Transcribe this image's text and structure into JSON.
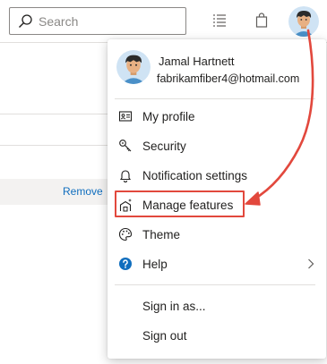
{
  "header": {
    "search_placeholder": "Search",
    "icons": [
      "search-icon",
      "work-items-icon",
      "marketplace-bag-icon",
      "user-avatar"
    ]
  },
  "background": {
    "remove_link": "Remove"
  },
  "profile": {
    "name": "Jamal Hartnett",
    "email": "fabrikamfiber4@hotmail.com"
  },
  "menu": {
    "items": [
      {
        "label": "My profile",
        "icon": "id-card-icon"
      },
      {
        "label": "Security",
        "icon": "key-icon"
      },
      {
        "label": "Notification settings",
        "icon": "bell-icon"
      },
      {
        "label": "Manage features",
        "icon": "preview-features-icon",
        "highlighted": true
      },
      {
        "label": "Theme",
        "icon": "palette-icon"
      },
      {
        "label": "Help",
        "icon": "help-icon",
        "has_submenu": true
      },
      {
        "label": "Sign in as...",
        "icon": ""
      },
      {
        "label": "Sign out",
        "icon": ""
      }
    ]
  },
  "colors": {
    "callout_red": "#e2483d",
    "help_blue": "#106ebe",
    "link_blue": "#106ebe"
  }
}
